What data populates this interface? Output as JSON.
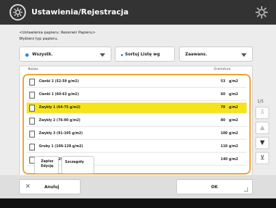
{
  "header": {
    "title": "Ustawienia/Rejestracja"
  },
  "info": {
    "line1": "<Ustawienia papieru: Rezerwir Papieru>",
    "line2": "Wybierz typ papieru."
  },
  "filter": {
    "selected": "Wszystk."
  },
  "sort": {
    "label": "Sortuj Listę wg"
  },
  "sort_order": {
    "selected": "Zaawans."
  },
  "columns": {
    "name": "Nazwa",
    "weight": "Gramatura"
  },
  "rows": [
    {
      "name": "Cienki 2 (52-59 g/m2)",
      "weight": "53",
      "unit": "g/m2",
      "selected": false
    },
    {
      "name": "Cienki 1 (60-63 g/m2)",
      "weight": "60",
      "unit": "g/m2",
      "selected": false
    },
    {
      "name": "Zwykły 1 (64-75 g/m2)",
      "weight": "70",
      "unit": "g/m2",
      "selected": true
    },
    {
      "name": "Zwykły 2 (76-90 g/m2)",
      "weight": "80",
      "unit": "g/m2",
      "selected": false
    },
    {
      "name": "Zwykły 3 (91-105 g/m2)",
      "weight": "100",
      "unit": "g/m2",
      "selected": false
    },
    {
      "name": "Gruby 1 (106-128 g/m2)",
      "weight": "110",
      "unit": "g/m2",
      "selected": false
    },
    {
      "name": "Gruby 2 (129-150 g/m2)",
      "weight": "140",
      "unit": "g/m2",
      "selected": false
    }
  ],
  "pager": {
    "page": "1/5"
  },
  "actions": {
    "edit": "Zapisz Edycję",
    "details": "Szczegóły"
  },
  "footer": {
    "cancel": "Anuluj",
    "ok": "OK"
  },
  "colors": {
    "header": "#333333",
    "frame": "#f0a030",
    "selected": "#f6e41a",
    "dot": "#2a8bd8"
  }
}
